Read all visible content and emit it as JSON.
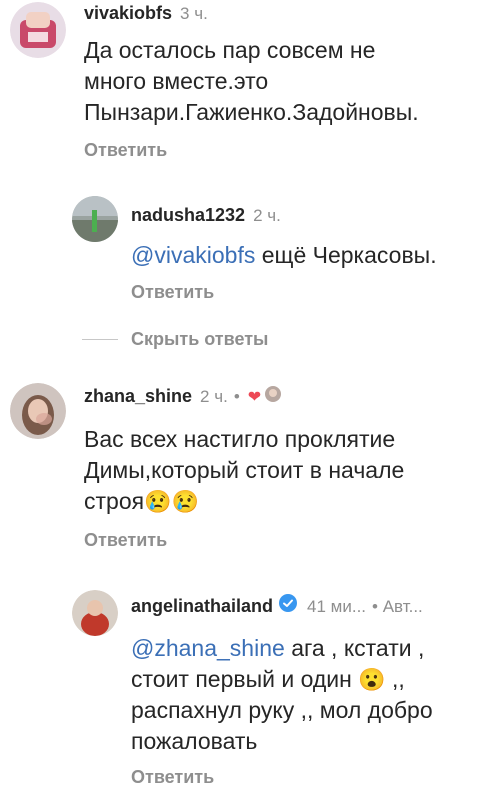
{
  "comments": [
    {
      "username": "vivakiobfs",
      "time": "3 ч.",
      "text_lines": [
        "Да осталось пар совсем не",
        "много вместе.это",
        "Пынзари.Гажиенко.Задойновы."
      ],
      "reply_label": "Ответить"
    },
    {
      "username": "nadusha1232",
      "time": "2 ч.",
      "mention": "@vivakiobfs",
      "text": "ещё Черкасовы.",
      "reply_label": "Ответить"
    },
    {
      "username": "zhana_shine",
      "time": "2 ч.",
      "dot": "•",
      "text_lines": [
        "Вас всех настигло проклятие",
        "Димы,который стоит в начале",
        "строя"
      ],
      "emojis": "😢😢",
      "reply_label": "Ответить"
    },
    {
      "username": "angelinathailand",
      "time": "41 ми...",
      "author_tag": "• Авт...",
      "mention": "@zhana_shine",
      "line1_rest": "ага , кстати ,",
      "line2": "стоит первый и один",
      "line2_emoji": "😮",
      "line2_end": ",,",
      "line3": "распахнул руку ,, мол добро",
      "line4": "пожаловать",
      "reply_label": "Ответить"
    }
  ],
  "hide_replies_label": "Скрыть ответы",
  "colors": {
    "mention": "#3b6fb6",
    "muted": "#8e8e8e",
    "text": "#262626",
    "heart": "#ed4956",
    "verified": "#3897f0"
  },
  "icons": [
    "heart-icon",
    "verified-badge-icon"
  ]
}
